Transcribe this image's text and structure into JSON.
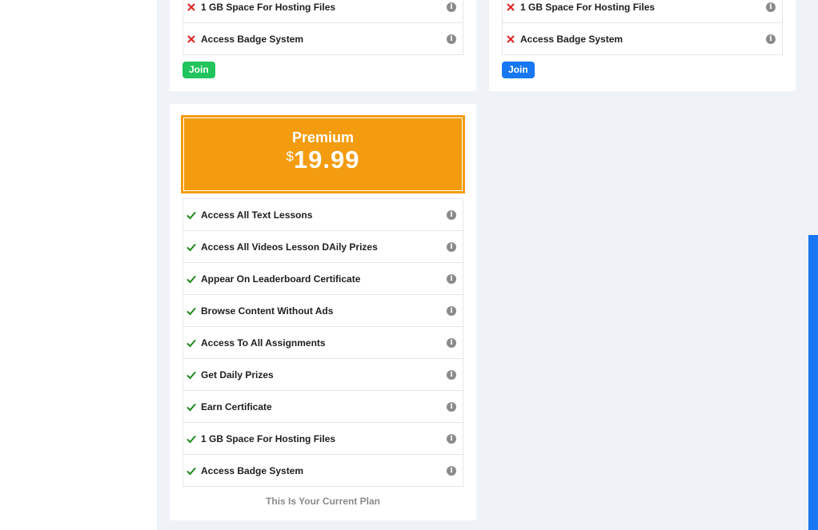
{
  "colors": {
    "check": "#1a8a1a",
    "cross": "#e02020",
    "premium_bg": "#f39c0f",
    "join_green": "#21c45d",
    "join_blue": "#1877f2",
    "scroll_thumb": "#1877f2"
  },
  "cards_top": [
    {
      "features": [
        {
          "label": "1 GB Space For Hosting Files",
          "included": false,
          "icon": "cross-icon"
        },
        {
          "label": "Access Badge System",
          "included": false,
          "icon": "cross-icon"
        }
      ],
      "join_label": "Join",
      "join_color": "#21c45d"
    },
    {
      "features": [
        {
          "label": "1 GB Space For Hosting Files",
          "included": false,
          "icon": "cross-icon"
        },
        {
          "label": "Access Badge System",
          "included": false,
          "icon": "cross-icon"
        }
      ],
      "join_label": "Join",
      "join_color": "#1877f2"
    }
  ],
  "premium": {
    "name": "Premium",
    "currency": "$",
    "price": "19.99",
    "features": [
      {
        "label": "Access All Text Lessons",
        "included": true,
        "icon": "check-icon"
      },
      {
        "label": "Access All Videos Lesson DAily Prizes",
        "included": true,
        "icon": "check-icon"
      },
      {
        "label": "Appear On Leaderboard Certificate",
        "included": true,
        "icon": "check-icon"
      },
      {
        "label": "Browse Content Without Ads",
        "included": true,
        "icon": "check-icon"
      },
      {
        "label": "Access To All Assignments",
        "included": true,
        "icon": "check-icon"
      },
      {
        "label": "Get Daily Prizes",
        "included": true,
        "icon": "check-icon"
      },
      {
        "label": "Earn Certificate",
        "included": true,
        "icon": "check-icon"
      },
      {
        "label": "1 GB Space For Hosting Files",
        "included": true,
        "icon": "check-icon"
      },
      {
        "label": "Access Badge System",
        "included": true,
        "icon": "check-icon"
      }
    ],
    "current_plan_text": "This Is Your Current Plan"
  },
  "info_icon_glyph": "i"
}
